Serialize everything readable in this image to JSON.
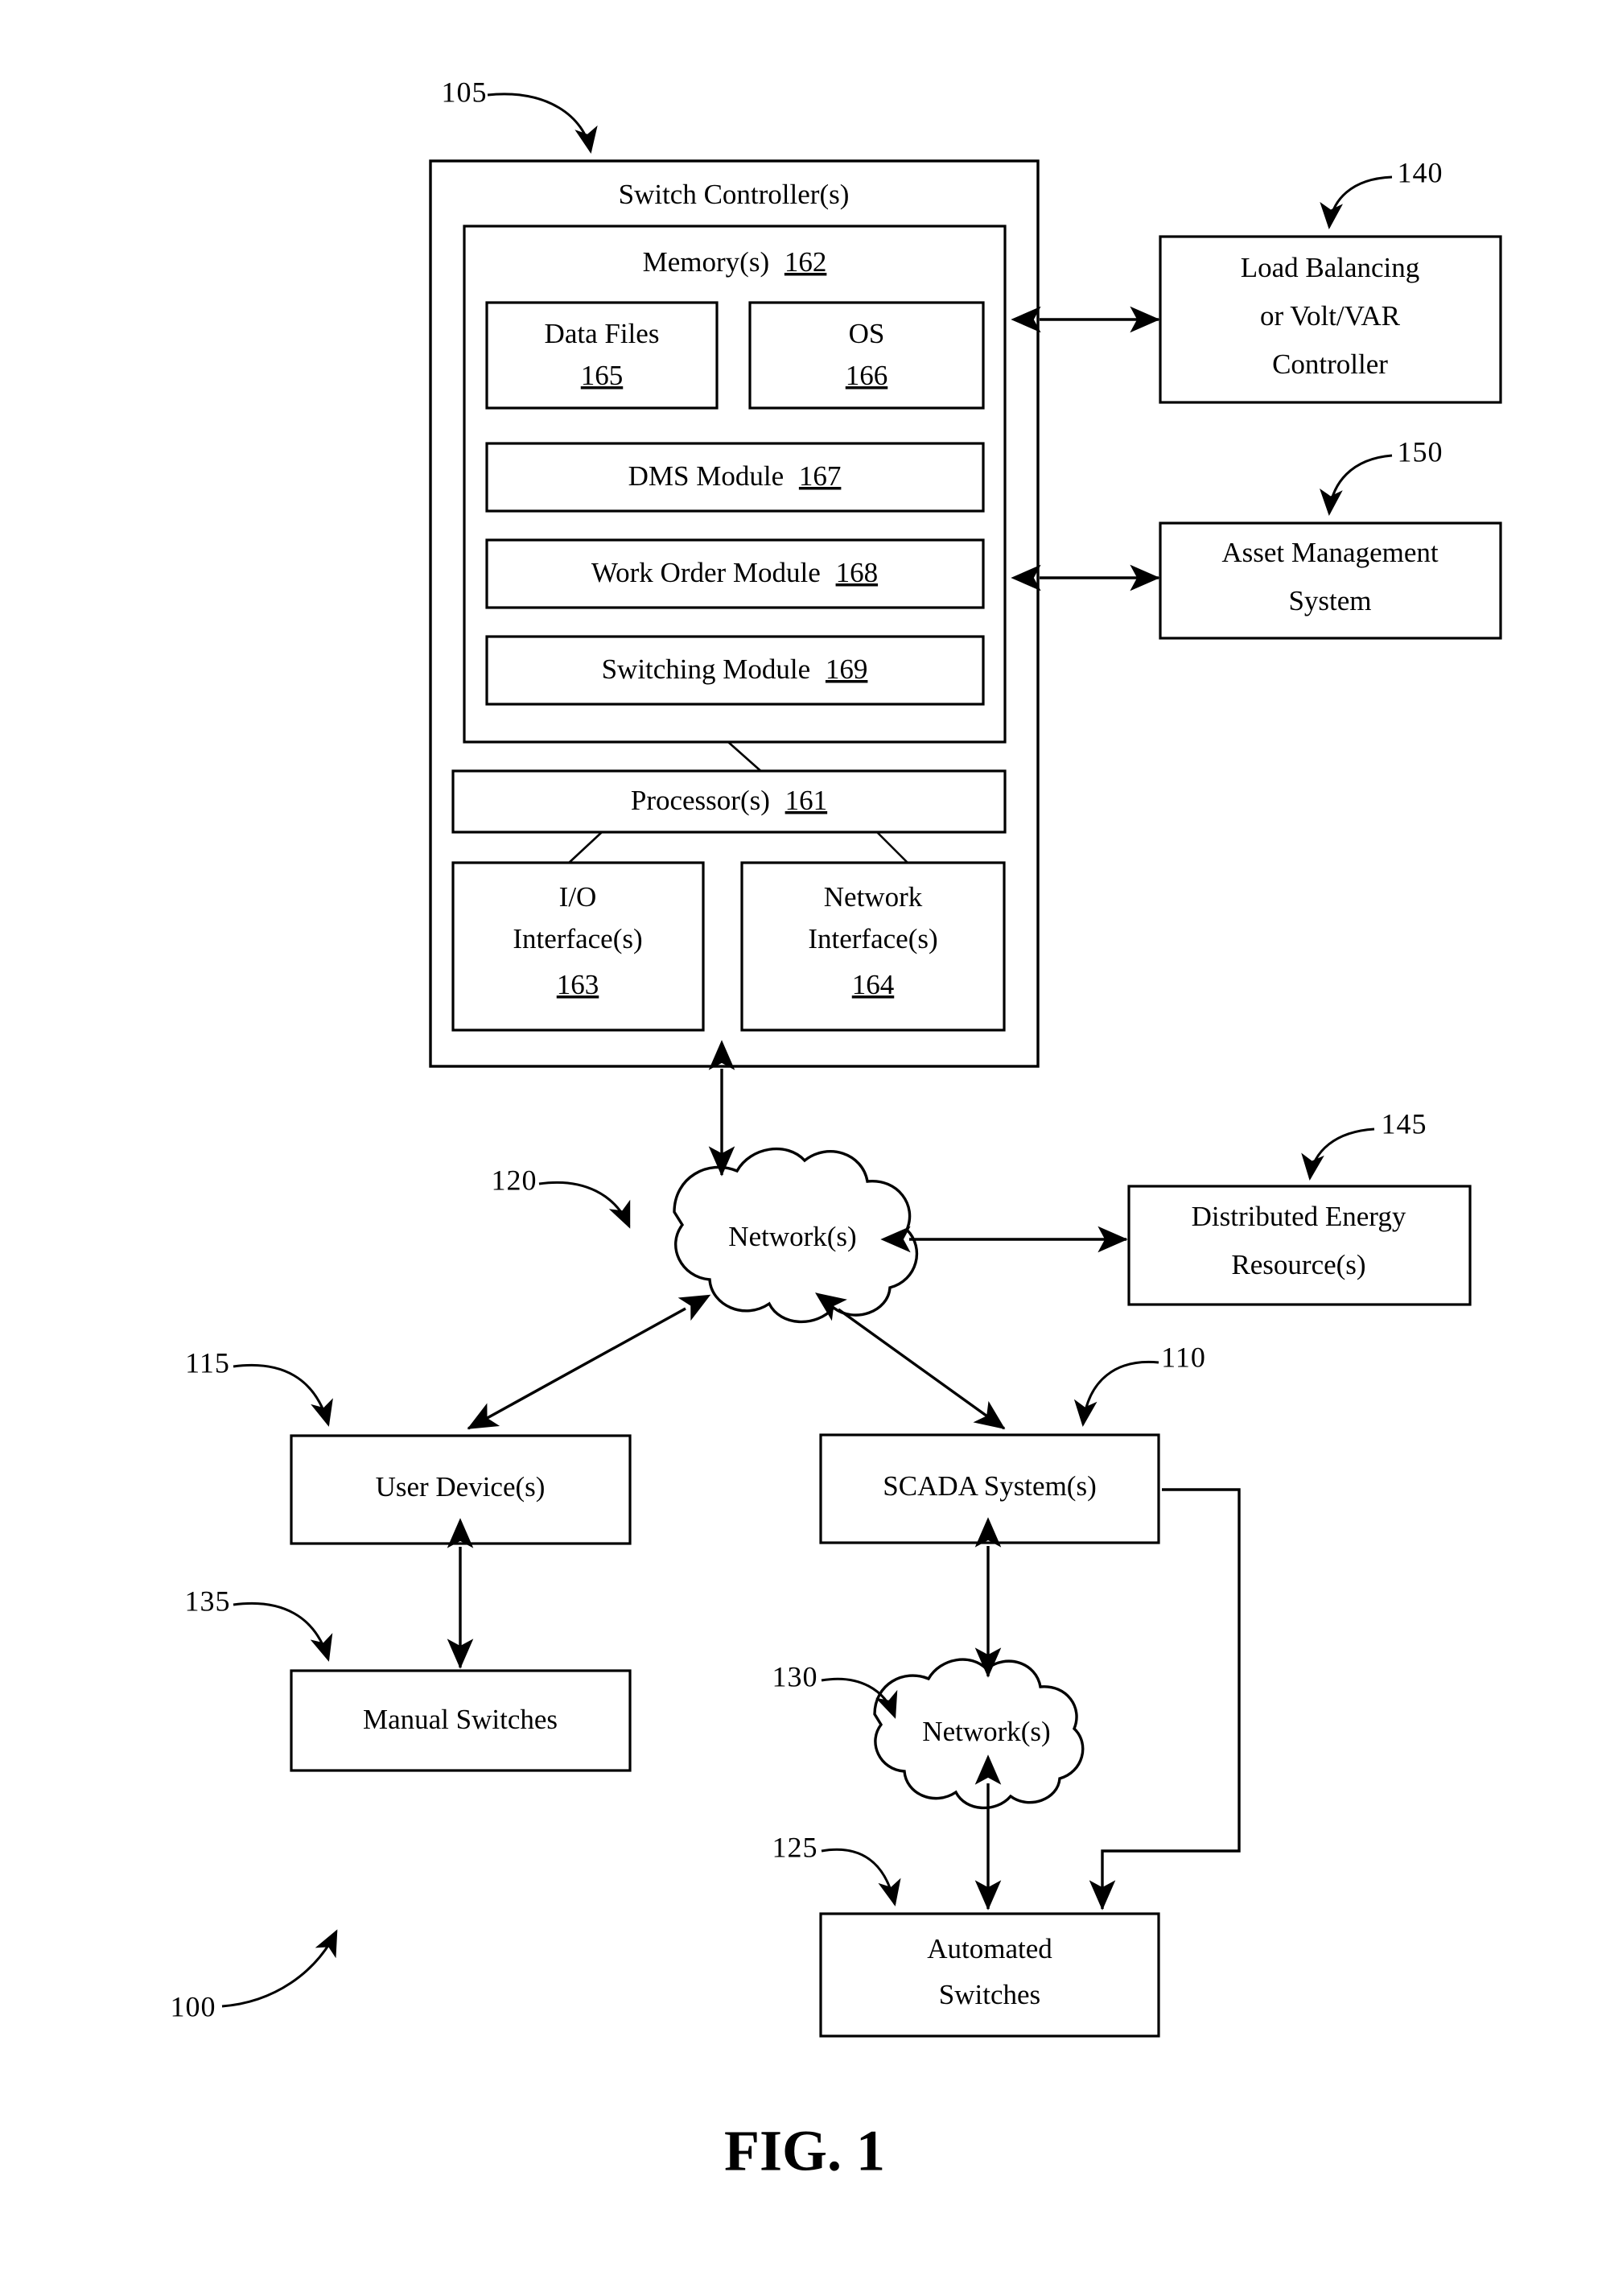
{
  "figure": {
    "title": "FIG. 1",
    "system_ref": "100"
  },
  "switch_controller": {
    "ref": "105",
    "title": "Switch Controller(s)",
    "memory": {
      "ref": "162",
      "title": "Memory(s)",
      "title_full": "Memory(s) 162",
      "items": [
        {
          "label": "Data Files",
          "ref": "165"
        },
        {
          "label": "OS",
          "ref": "166"
        },
        {
          "label": "DMS Module",
          "ref": "167",
          "label_full": "DMS Module 167"
        },
        {
          "label": "Work Order Module",
          "ref": "168",
          "label_full": "Work Order Module 168"
        },
        {
          "label": "Switching Module",
          "ref": "169",
          "label_full": "Switching Module 169"
        }
      ]
    },
    "processor": {
      "label": "Processor(s)",
      "ref": "161",
      "label_full": "Processor(s) 161"
    },
    "io_interface": {
      "line1": "I/O",
      "line2": "Interface(s)",
      "ref": "163"
    },
    "network_interface": {
      "line1": "Network",
      "line2": "Interface(s)",
      "ref": "164"
    }
  },
  "peripherals": {
    "load_balancing": {
      "ref": "140",
      "line1": "Load Balancing",
      "line2": "or Volt/VAR",
      "line3": "Controller"
    },
    "asset_management": {
      "ref": "150",
      "line1": "Asset Management",
      "line2": "System"
    },
    "distributed_energy": {
      "ref": "145",
      "line1": "Distributed Energy",
      "line2": "Resource(s)"
    }
  },
  "network_top": {
    "ref": "120",
    "label": "Network(s)"
  },
  "network_bottom": {
    "ref": "130",
    "label": "Network(s)"
  },
  "user_device": {
    "ref": "115",
    "label": "User Device(s)"
  },
  "manual_switches": {
    "ref": "135",
    "label": "Manual Switches"
  },
  "scada": {
    "ref": "110",
    "label": "SCADA System(s)"
  },
  "automated_switches": {
    "ref": "125",
    "line1": "Automated",
    "line2": "Switches"
  },
  "colors": {
    "ink": "#000000",
    "paper": "#ffffff"
  }
}
